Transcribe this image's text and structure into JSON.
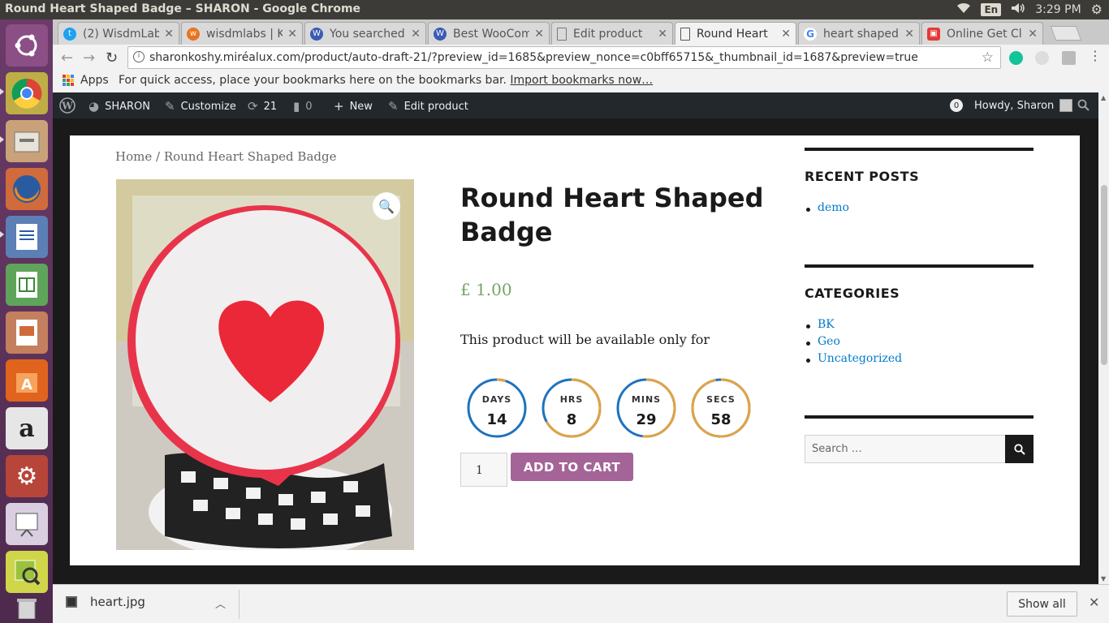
{
  "os": {
    "window_title": "Round Heart Shaped Badge – SHARON - Google Chrome",
    "language": "En",
    "clock": "3:29 PM"
  },
  "tabs": [
    {
      "label": "(2) WisdmLabs",
      "icon": "twitter-icon",
      "color": "#1da1f2"
    },
    {
      "label": "wisdmlabs | K",
      "icon": "site-icon",
      "color": "#e8741e"
    },
    {
      "label": "You searched",
      "icon": "wa-icon",
      "color": "#3b5bb5"
    },
    {
      "label": "Best WooCom",
      "icon": "wa-icon",
      "color": "#3b5bb5"
    },
    {
      "label": "Edit product",
      "icon": "page-icon",
      "color": "#777777"
    },
    {
      "label": "Round Heart",
      "icon": "page-icon",
      "color": "#777777",
      "active": true
    },
    {
      "label": "heart shaped",
      "icon": "google-icon",
      "color": "#4285f4"
    },
    {
      "label": "Online Get Cl",
      "icon": "online-icon",
      "color": "#e53935"
    }
  ],
  "address_bar": {
    "url": "sharonkoshy.miréalux.com/product/auto-draft-21/?preview_id=1685&preview_nonce=c0bff65715&_thumbnail_id=1687&preview=true"
  },
  "bookmarks_bar": {
    "apps_label": "Apps",
    "message": "For quick access, place your bookmarks here on the bookmarks bar.",
    "import_link": "Import bookmarks now…"
  },
  "admin_bar": {
    "site_name": "SHARON",
    "customize": "Customize",
    "updates": "21",
    "comments": "0",
    "new": "New",
    "edit_product": "Edit product",
    "notifications": "0",
    "greeting": "Howdy, Sharon"
  },
  "breadcrumb": {
    "home": "Home",
    "separator": " / ",
    "current": "Round Heart Shaped Badge"
  },
  "product": {
    "title": "Round Heart Shaped Badge",
    "price": "£ 1.00",
    "availability": "This product will be available only for",
    "quantity": "1",
    "add_to_cart": "ADD TO CART"
  },
  "countdown": [
    {
      "label": "DAYS",
      "value": "14",
      "fraction": 0.95
    },
    {
      "label": "HRS",
      "value": "8",
      "fraction": 0.33
    },
    {
      "label": "MINS",
      "value": "29",
      "fraction": 0.48
    },
    {
      "label": "SECS",
      "value": "58",
      "fraction": 0.03
    }
  ],
  "countdown_colors": {
    "elapsed": "#e2a344",
    "remaining": "#1e73be"
  },
  "sidebar": {
    "recent_posts_title": "RECENT POSTS",
    "recent_posts": [
      "demo"
    ],
    "categories_title": "CATEGORIES",
    "categories": [
      "BK",
      "Geo",
      "Uncategorized"
    ],
    "search_placeholder": "Search …"
  },
  "downloads": {
    "file": "heart.jpg",
    "show_all": "Show all"
  },
  "colors": {
    "price": "#77a464",
    "button": "#a46497",
    "link": "#007acc",
    "admin_bar": "#23282d"
  }
}
